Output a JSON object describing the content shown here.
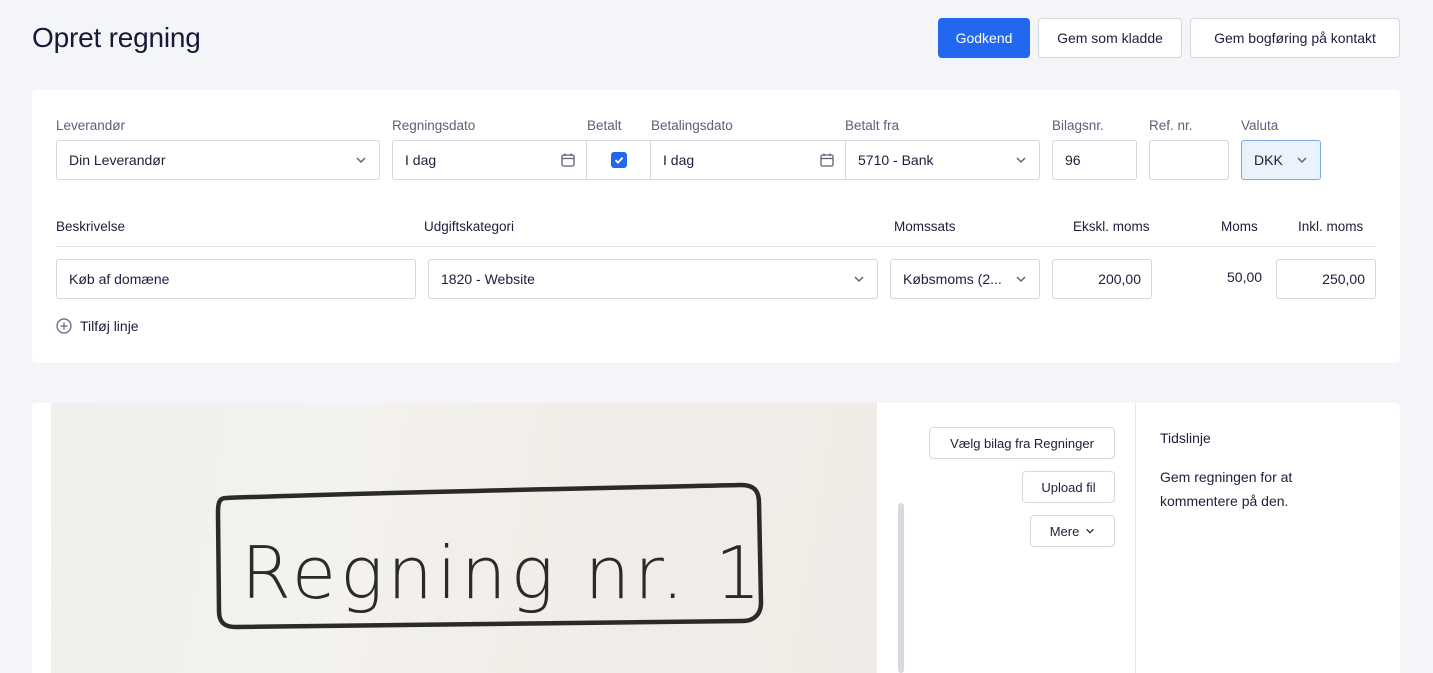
{
  "page": {
    "title": "Opret regning"
  },
  "actions": {
    "approve": "Godkend",
    "save_draft": "Gem som kladde",
    "save_posting": "Gem bogføring på kontakt"
  },
  "form": {
    "supplier": {
      "label": "Leverandør",
      "value": "Din Leverandør"
    },
    "bill_date": {
      "label": "Regningsdato",
      "value": "I dag"
    },
    "paid": {
      "label": "Betalt",
      "checked": true
    },
    "payment_date": {
      "label": "Betalingsdato",
      "value": "I dag"
    },
    "paid_from": {
      "label": "Betalt fra",
      "value": "5710 - Bank"
    },
    "voucher_no": {
      "label": "Bilagsnr.",
      "value": "96"
    },
    "ref_no": {
      "label": "Ref. nr.",
      "value": ""
    },
    "currency": {
      "label": "Valuta",
      "value": "DKK"
    }
  },
  "lines": {
    "headers": {
      "description": "Beskrivelse",
      "category": "Udgiftskategori",
      "vat_rate": "Momssats",
      "excl_vat": "Ekskl. moms",
      "vat": "Moms",
      "incl_vat": "Inkl. moms"
    },
    "rows": [
      {
        "description": "Køb af domæne",
        "category": "1820 - Website",
        "vat_rate": "Købsmoms (2...",
        "excl_vat": "200,00",
        "vat": "50,00",
        "incl_vat": "250,00"
      }
    ],
    "add_line": "Tilføj linje"
  },
  "attachment": {
    "handwritten_text": "Regning nr. 1",
    "choose_from_bills": "Vælg bilag fra Regninger",
    "upload": "Upload fil",
    "more": "Mere"
  },
  "timeline": {
    "title": "Tidslinje",
    "text": "Gem regningen for at kommentere på den."
  },
  "colors": {
    "primary": "#2268ee",
    "background": "#f3f5f9",
    "currency_bg": "#eaf2fb"
  }
}
